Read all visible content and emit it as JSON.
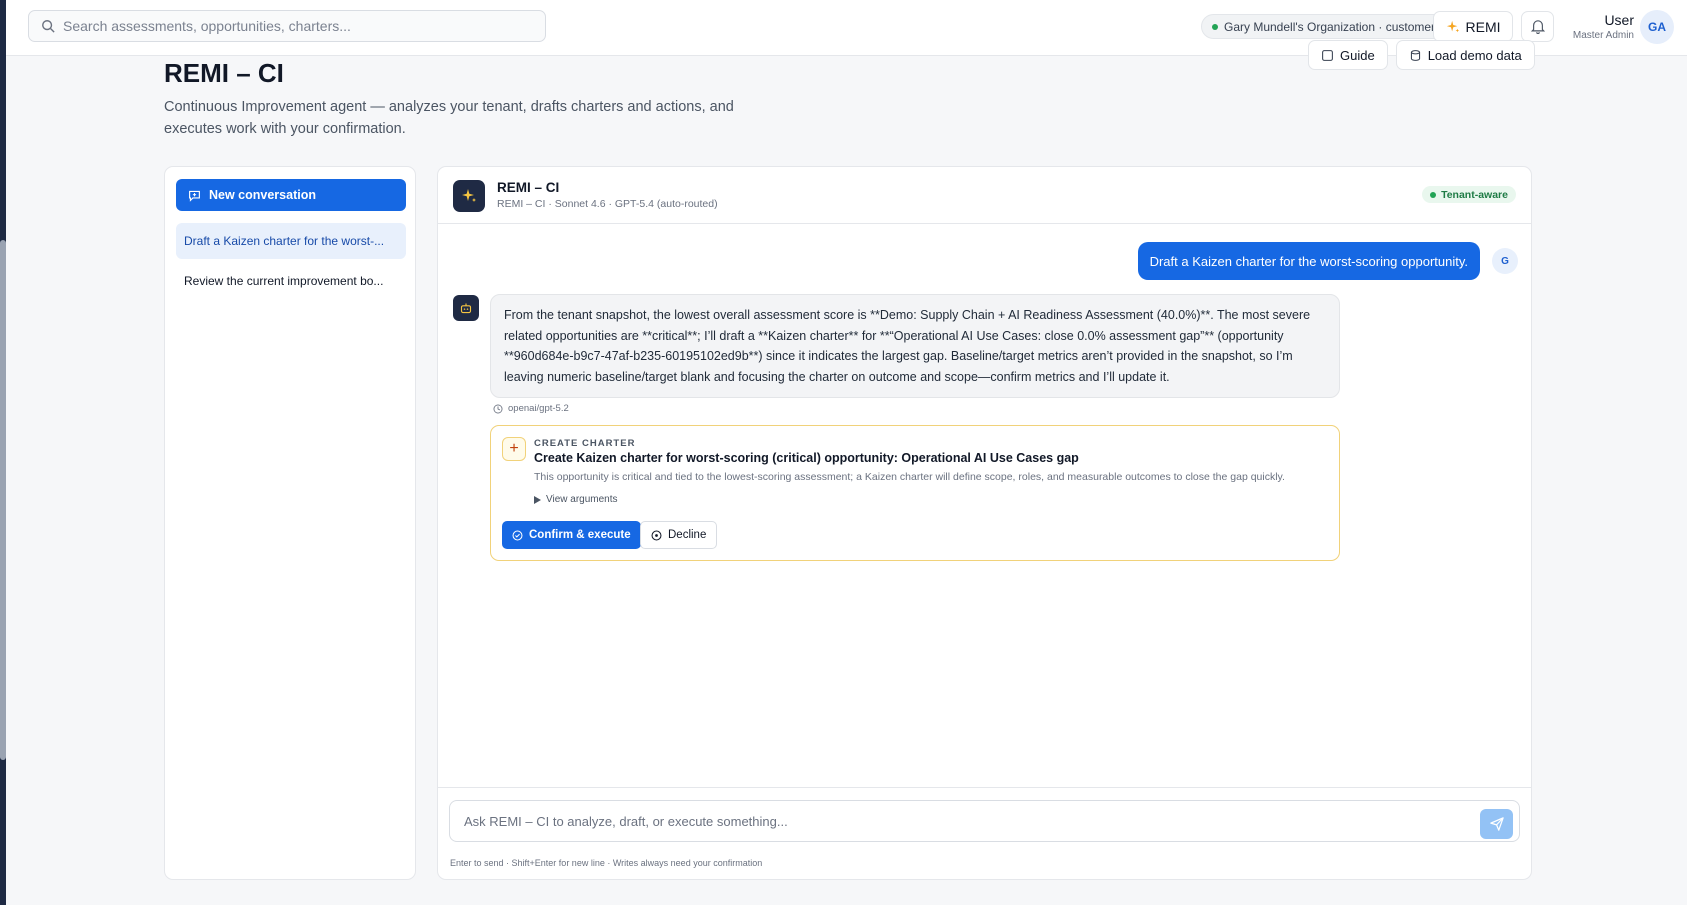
{
  "search": {
    "placeholder": "Search assessments, opportunities, charters..."
  },
  "topbar": {
    "org_label": "Gary Mundell's Organization · customer",
    "remi_label": "REMI",
    "user_name": "User",
    "user_role": "Master Admin",
    "avatar_initials": "GA"
  },
  "page": {
    "title": "REMI – CI",
    "description": "Continuous Improvement agent — analyzes your tenant, drafts charters and actions, and executes work with your confirmation.",
    "header_buttons": [
      "Guide",
      "Load demo data"
    ]
  },
  "sidebar": {
    "new_conversation_label": "New conversation",
    "conversations": [
      {
        "label": "Draft a Kaizen charter for the worst-...",
        "active": true
      },
      {
        "label": "Review the current improvement bo...",
        "active": false
      }
    ]
  },
  "chat": {
    "agent_name": "REMI – CI",
    "agent_meta": "REMI – CI · Sonnet 4.6 · GPT-5.4 (auto-routed)",
    "tenant_badge": "Tenant-aware",
    "user_message": "Draft a Kaizen charter for the worst-scoring opportunity.",
    "user_avatar": "G",
    "assistant_message": "From the tenant snapshot, the lowest overall assessment score is **Demo: Supply Chain + AI Readiness Assessment (40.0%)**. The most severe related opportunities are **critical**; I’ll draft a **Kaizen charter** for **“Operational AI Use Cases: close 0.0% assessment gap”** (opportunity **960d684e-b9c7-47af-b235-60195102ed9b**) since it indicates the largest gap. Baseline/target metrics aren’t provided in the snapshot, so I’m leaving numeric baseline/target blank and focusing the charter on outcome and scope—confirm metrics and I’ll update it.",
    "model_tag": "openai/gpt-5.2",
    "action": {
      "eyebrow": "CREATE CHARTER",
      "title": "Create Kaizen charter for worst-scoring (critical) opportunity: Operational AI Use Cases gap",
      "description": "This opportunity is critical and tied to the lowest-scoring assessment; a Kaizen charter will define scope, roles, and measurable outcomes to close the gap quickly.",
      "args_label": "View arguments",
      "confirm_label": "Confirm & execute",
      "decline_label": "Decline"
    },
    "composer_placeholder": "Ask REMI – CI to analyze, draft, or execute something...",
    "composer_hint": "Enter to send · Shift+Enter for new line · Writes always need your confirmation"
  },
  "colors": {
    "primary": "#1668e3",
    "sidebar_dark": "#1e2a44",
    "success": "#22a355",
    "warning_border": "#f1d27a"
  }
}
